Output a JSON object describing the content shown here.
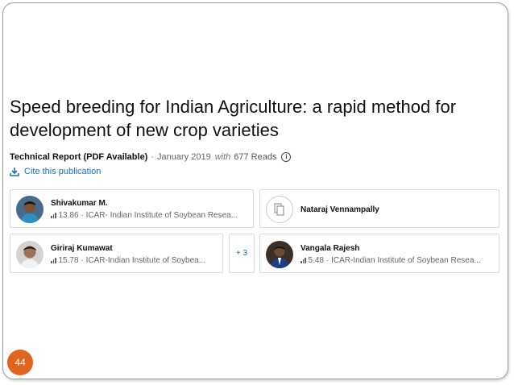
{
  "publication": {
    "title": "Speed breeding for Indian Agriculture: a rapid method for development of new crop varieties",
    "type": "Technical Report (PDF Available)",
    "separator": "·",
    "date": "January 2019",
    "with_label": "with",
    "reads": "677 Reads",
    "cite_label": "Cite this publication"
  },
  "authors": [
    {
      "name": "Shivakumar M.",
      "score": "13.86",
      "affiliation": "· ICAR- Indian Institute of Soybean Resea..."
    },
    {
      "name": "Nataraj Vennampally",
      "score": "",
      "affiliation": ""
    },
    {
      "name": "Giriraj Kumawat",
      "score": "15.78",
      "affiliation": "· ICAR-Indian Institute of Soybea..."
    },
    {
      "name": "Vangala Rajesh",
      "score": "5.48",
      "affiliation": "· ICAR-Indian Institute of Soybean Resea..."
    }
  ],
  "more_authors": "+ 3",
  "slide": {
    "page_number": "44",
    "accent_color": "#e0641e",
    "link_color": "#1a6fb5"
  }
}
